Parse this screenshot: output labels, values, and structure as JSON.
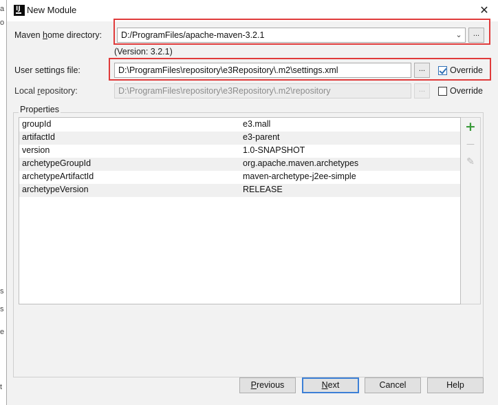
{
  "background_window": {
    "chars": [
      "a",
      "o",
      "",
      "",
      "",
      "",
      "",
      "",
      "",
      "",
      "",
      "s",
      "s",
      "e",
      "t"
    ]
  },
  "window": {
    "title": "New Module",
    "close_glyph": "✕"
  },
  "maven_home": {
    "label_pre": "Maven ",
    "label_mnemonic": "h",
    "label_post": "ome directory:",
    "value": "D:/ProgramFiles/apache-maven-3.2.1",
    "browse_label": "...",
    "version_note": "(Version: 3.2.1)"
  },
  "user_settings": {
    "label": "User settings file:",
    "value": "D:\\ProgramFiles\\repository\\e3Repository\\.m2\\settings.xml",
    "browse_label": "...",
    "override_label": "Override",
    "override_checked": true
  },
  "local_repository": {
    "label_pre": "Local ",
    "label_mnemonic": "r",
    "label_post": "epository:",
    "value": "D:\\ProgramFiles\\repository\\e3Repository\\.m2\\repository",
    "browse_label": "...",
    "override_label": "Override",
    "override_checked": false
  },
  "properties": {
    "group_label": "Properties",
    "rows": [
      {
        "key": "groupId",
        "value": "e3.mall"
      },
      {
        "key": "artifactId",
        "value": "e3-parent"
      },
      {
        "key": "version",
        "value": "1.0-SNAPSHOT"
      },
      {
        "key": "archetypeGroupId",
        "value": "org.apache.maven.archetypes"
      },
      {
        "key": "archetypeArtifactId",
        "value": "maven-archetype-j2ee-simple"
      },
      {
        "key": "archetypeVersion",
        "value": "RELEASE"
      }
    ],
    "add_glyph": "+",
    "remove_glyph": "—",
    "edit_glyph": "✎"
  },
  "buttons": {
    "previous_mnemonic": "P",
    "previous_rest": "revious",
    "next_mnemonic": "N",
    "next_rest": "ext",
    "cancel": "Cancel",
    "help": "Help"
  },
  "colors": {
    "highlight_red": "#e03a3a",
    "add_green": "#3a9a3a",
    "default_button_blue": "#3c7fd6"
  }
}
